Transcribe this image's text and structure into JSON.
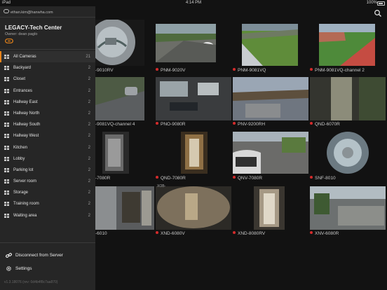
{
  "status_bar": {
    "carrier": "iPad",
    "time": "4:14 PM",
    "battery": "100%"
  },
  "sidebar": {
    "account_email": "ethan.kim@hanwha.com",
    "site_name": "LEGACY-Tech Center",
    "owner": "Owner: dean paglo",
    "accent_color": "#e8841a",
    "groups": [
      {
        "label": "All Cameras",
        "count": "21",
        "active": true
      },
      {
        "label": "Backyard",
        "count": "2"
      },
      {
        "label": "Closet",
        "count": "2"
      },
      {
        "label": "Entrances",
        "count": "2"
      },
      {
        "label": "Hallway East",
        "count": "2"
      },
      {
        "label": "Hallway North",
        "count": "2"
      },
      {
        "label": "Hallway South",
        "count": "2"
      },
      {
        "label": "Hallway West",
        "count": "2"
      },
      {
        "label": "Kitchen",
        "count": "2"
      },
      {
        "label": "Lobby",
        "count": "2"
      },
      {
        "label": "Parking lot",
        "count": "2"
      },
      {
        "label": "Server room",
        "count": "2"
      },
      {
        "label": "Storage",
        "count": "2"
      },
      {
        "label": "Training room",
        "count": "2"
      },
      {
        "label": "Waiting area",
        "count": "2"
      }
    ],
    "disconnect_label": "Disconnect from Server",
    "settings_label": "Settings",
    "version": "v1.3.18076 (rev: 0d4b4f8c7aa870)"
  },
  "cameras": [
    {
      "name": "-9010RV",
      "status_color": ""
    },
    {
      "name": "PNM-9020V",
      "status_color": "#d52b2b"
    },
    {
      "name": "PNM-9081VQ",
      "status_color": "#d52b2b"
    },
    {
      "name": "PNM-9081VQ-channel 2",
      "status_color": "#d52b2b"
    },
    {
      "name": "-9081VQ-channel 4",
      "status_color": ""
    },
    {
      "name": "PNO-9080R",
      "status_color": "#d52b2b"
    },
    {
      "name": "PNV-9200RH",
      "status_color": "#d52b2b"
    },
    {
      "name": "QND-6070R",
      "status_color": "#d52b2b"
    },
    {
      "name": "-7080R",
      "status_color": ""
    },
    {
      "name": "QND-7080R",
      "status_color": "#d52b2b"
    },
    {
      "name": "QNV-7080R",
      "status_color": "#d52b2b"
    },
    {
      "name": "SNF-8010",
      "status_color": "#d52b2b"
    },
    {
      "name": "-6010",
      "status_color": ""
    },
    {
      "name": "XND-6080V",
      "status_color": "#d52b2b"
    },
    {
      "name": "XND-8080RV",
      "status_color": "#d52b2b"
    },
    {
      "name": "XNV-6080R",
      "status_color": "#d52b2b"
    }
  ],
  "overlay_text": "XOB-"
}
